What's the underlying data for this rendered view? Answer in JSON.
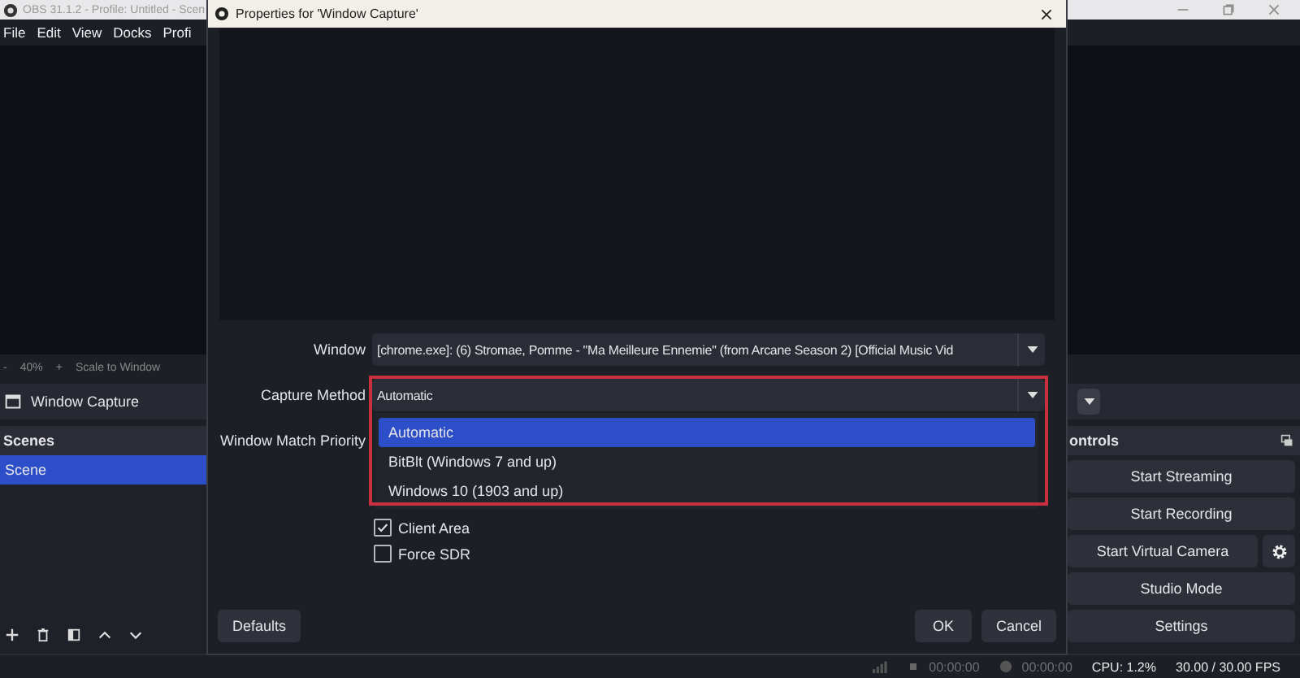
{
  "obs_window": {
    "title": "OBS 31.1.2 - Profile: Untitled - Scen",
    "menu": [
      {
        "label": "File"
      },
      {
        "label": "Edit"
      },
      {
        "label": "View"
      },
      {
        "label": "Docks"
      },
      {
        "label": "Profi"
      }
    ],
    "preview_toolbar": {
      "minus": "-",
      "zoom": "40%",
      "plus": "+",
      "scale_label": "Scale to Window"
    },
    "source": {
      "name": "Window Capture"
    },
    "scenes": {
      "title": "Scenes",
      "items": [
        {
          "name": "Scene",
          "selected": true
        }
      ]
    },
    "controls": {
      "title": "ontrols",
      "buttons": [
        {
          "label": "Start Streaming",
          "kind": "plain"
        },
        {
          "label": "Start Recording",
          "kind": "plain"
        },
        {
          "label": "Start Virtual Camera",
          "kind": "with-settings"
        },
        {
          "label": "Studio Mode",
          "kind": "plain"
        },
        {
          "label": "Settings",
          "kind": "plain"
        }
      ]
    },
    "status_bar": {
      "stream_time": "00:00:00",
      "record_time": "00:00:00",
      "cpu": "CPU: 1.2%",
      "fps": "30.00 / 30.00 FPS"
    }
  },
  "dialog": {
    "title": "Properties for 'Window Capture'",
    "fields": [
      {
        "label": "Window",
        "value": "[chrome.exe]: (6) Stromae, Pomme - \"Ma Meilleure Ennemie\" (from Arcane Season 2) [Official Music Vid",
        "expanded": false,
        "highlighted": false
      },
      {
        "label": "Capture Method",
        "value": "Automatic",
        "expanded": true,
        "highlighted": true,
        "options": [
          {
            "label": "Automatic",
            "selected": true
          },
          {
            "label": "BitBlt (Windows 7 and up)",
            "selected": false
          },
          {
            "label": "Windows 10 (1903 and up)",
            "selected": false
          }
        ]
      },
      {
        "label": "Window Match Priority"
      }
    ],
    "checkboxes": [
      {
        "label": "Client Area",
        "checked": true
      },
      {
        "label": "Force SDR",
        "checked": false
      }
    ],
    "buttons": {
      "defaults": "Defaults",
      "ok": "OK",
      "cancel": "Cancel"
    }
  }
}
